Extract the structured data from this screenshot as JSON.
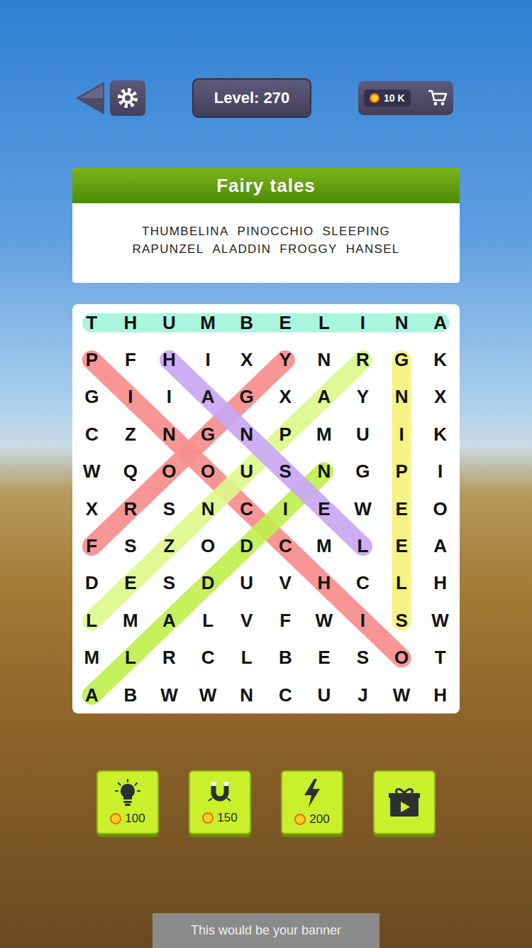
{
  "top_bar": {
    "level": "Level: 270",
    "coins": "10 K"
  },
  "category": "Fairy tales",
  "words": [
    {
      "text": "THUMBELINA",
      "found": true,
      "color": "#a3f5dc",
      "from": [
        0,
        0
      ],
      "to": [
        0,
        9
      ]
    },
    {
      "text": "PINOCCHIO",
      "found": true,
      "color": "#f88e8e",
      "from": [
        1,
        0
      ],
      "to": [
        9,
        8
      ]
    },
    {
      "text": "SLEEPING",
      "found": true,
      "color": "#f5f27a",
      "from": [
        8,
        8
      ],
      "to": [
        1,
        8
      ]
    },
    {
      "text": "RAPUNZEL",
      "found": true,
      "color": "#def98c",
      "from": [
        1,
        7
      ],
      "to": [
        8,
        0
      ]
    },
    {
      "text": "ALADDIN",
      "found": true,
      "color": "#bff04f",
      "from": [
        10,
        0
      ],
      "to": [
        4,
        6
      ]
    },
    {
      "text": "FROGGY",
      "found": true,
      "color": "#f88e8e",
      "from": [
        6,
        0
      ],
      "to": [
        1,
        5
      ]
    },
    {
      "text": "HANSEL",
      "found": true,
      "color": "#c9a8f5",
      "from": [
        1,
        2
      ],
      "to": [
        6,
        7
      ]
    }
  ],
  "grid": [
    "THUMBELINA",
    "PFHIXYNRGK",
    "GIIAGXAYNX",
    "CZNGNPMUIK",
    "WQOOUSNGPI",
    "XRSNCIEWEO",
    "FSZODCMLEA",
    "DESDUVHCLH",
    "LMALVFWISW",
    "MLRCLBESOT",
    "ABWWNCUJWH"
  ],
  "powerups": [
    {
      "kind": "hint",
      "cost": "100"
    },
    {
      "kind": "magnet",
      "cost": "150"
    },
    {
      "kind": "lightning",
      "cost": "200"
    },
    {
      "kind": "gift"
    }
  ],
  "banner": "This would be your banner"
}
